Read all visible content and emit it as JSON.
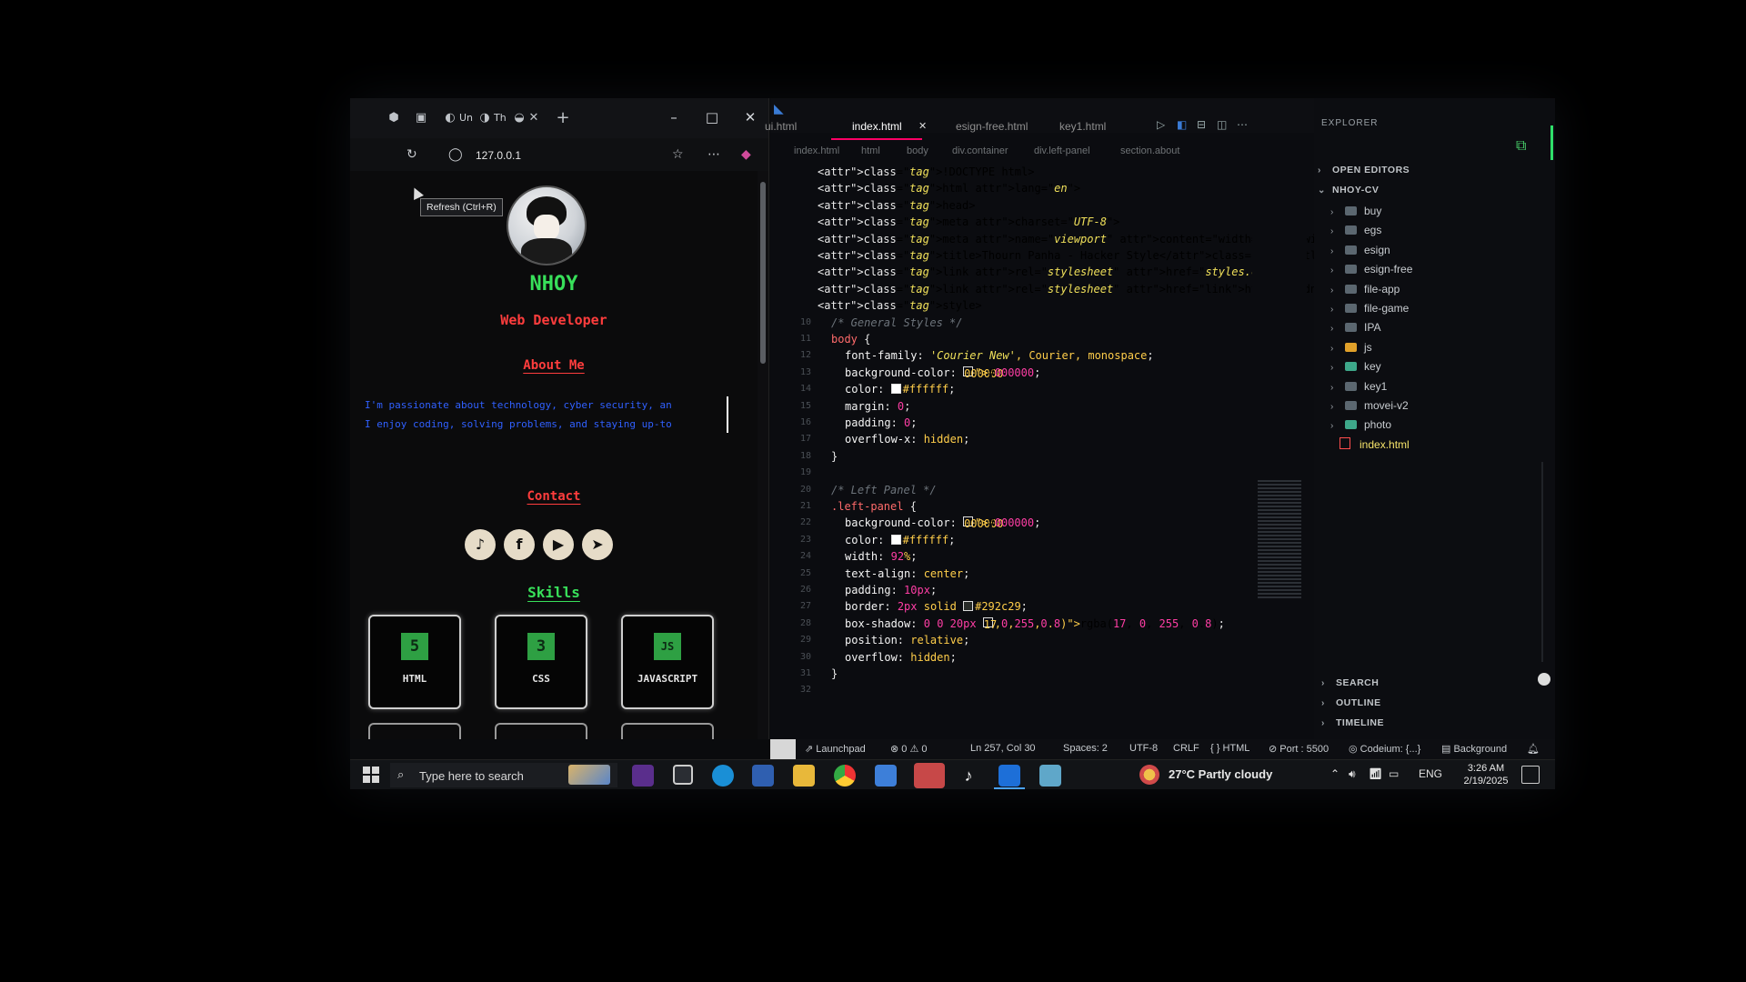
{
  "browser": {
    "tabs": [
      {
        "label": "Un"
      },
      {
        "label": "Th"
      }
    ],
    "new_tab": "+",
    "window": {
      "minimize": "–",
      "maximize": "□",
      "close": "✕"
    },
    "url": "127.0.0.1",
    "tooltip": "Refresh (Ctrl+R)",
    "more": "⋯"
  },
  "page": {
    "name": "NHOY",
    "role": "Web Developer",
    "about_title": "About Me",
    "about_lines": [
      "I'm passionate about technology, cyber security, an",
      "I enjoy coding, solving problems, and staying up-to"
    ],
    "contact_title": "Contact",
    "socials": [
      "♪",
      "f",
      "▶",
      "➤"
    ],
    "skills_title": "Skills",
    "skills": [
      {
        "icon": "5",
        "label": "HTML"
      },
      {
        "icon": "3",
        "label": "CSS"
      },
      {
        "icon": "JS",
        "label": "JAVASCRIPT"
      }
    ],
    "colors": {
      "name": "#38e05a",
      "role": "#ff3d3d",
      "about": "#3060ff"
    }
  },
  "editor": {
    "tabs": [
      {
        "label": "ui.html"
      },
      {
        "label": "index.html",
        "active": true
      },
      {
        "label": "esign-free.html"
      },
      {
        "label": "key1.html"
      }
    ],
    "breadcrumb": [
      "index.html",
      "html",
      "body",
      "div.container",
      "div.left-panel",
      "section.about"
    ],
    "lines": [
      {
        "n": "",
        "code": "<!DOCTYPE html>"
      },
      {
        "n": "",
        "code": "<html lang=\"en\">"
      },
      {
        "n": "",
        "code": "<head>"
      },
      {
        "n": "",
        "code": "<meta charset=\"UTF-8\">"
      },
      {
        "n": "",
        "code": "<meta name=\"viewport\" content=\"width=device-width, initial-"
      },
      {
        "n": "",
        "code": "<title>Thourn Panha - Hacker Style</title>"
      },
      {
        "n": "",
        "code": "<link rel=\"stylesheet\" href=\"styles.css\">"
      },
      {
        "n": "",
        "code": "<link rel=\"stylesheet\" href=\"https://cdnjs.cloudflare.com/a"
      },
      {
        "n": "",
        "code": "<style>"
      },
      {
        "n": "10",
        "code": "/* General Styles */"
      },
      {
        "n": "11",
        "code": "body {"
      },
      {
        "n": "12",
        "code": "font-family: 'Courier New', Courier, monospace;"
      },
      {
        "n": "13",
        "code": "background-color: #000000;"
      },
      {
        "n": "14",
        "code": "color: #ffffff;"
      },
      {
        "n": "15",
        "code": "margin: 0;"
      },
      {
        "n": "16",
        "code": "padding: 0;"
      },
      {
        "n": "17",
        "code": "overflow-x: hidden;"
      },
      {
        "n": "18",
        "code": "}"
      },
      {
        "n": "19",
        "code": ""
      },
      {
        "n": "20",
        "code": "/* Left Panel */"
      },
      {
        "n": "21",
        "code": ".left-panel {"
      },
      {
        "n": "22",
        "code": "background-color: #000000;"
      },
      {
        "n": "23",
        "code": "color: #ffffff;"
      },
      {
        "n": "24",
        "code": "width: 92%;"
      },
      {
        "n": "25",
        "code": "text-align: center;"
      },
      {
        "n": "26",
        "code": "padding: 10px;"
      },
      {
        "n": "27",
        "code": "border: 2px solid #292c29;"
      },
      {
        "n": "28",
        "code": "box-shadow: 0 0 20px rgba(17, 0, 255, 0.8);"
      },
      {
        "n": "29",
        "code": "position: relative;"
      },
      {
        "n": "30",
        "code": "overflow: hidden;"
      },
      {
        "n": "31",
        "code": "}"
      },
      {
        "n": "32",
        "code": ""
      }
    ]
  },
  "explorer": {
    "title": "EXPLORER",
    "open_editors": "OPEN EDITORS",
    "project": "NHOY-CV",
    "folders": [
      "buy",
      "egs",
      "esign",
      "esign-free",
      "file-app",
      "file-game",
      "IPA",
      "js",
      "key",
      "key1",
      "movei-v2",
      "photo"
    ],
    "file": "index.html",
    "bottom": [
      "SEARCH",
      "OUTLINE",
      "TIMELINE"
    ]
  },
  "statusbar": {
    "launchpad": "Launchpad",
    "problems": "⊗ 0 ⚠ 0",
    "position": "Ln 257, Col 30",
    "spaces": "Spaces: 2",
    "encoding": "UTF-8",
    "eol": "CRLF",
    "language": "{ } HTML",
    "port": "Port : 5500",
    "codeium": "Codeium: {...}",
    "background": "Background"
  },
  "taskbar": {
    "search_placeholder": "Type here to search",
    "weather": "27°C  Partly cloudy",
    "lang": "ENG",
    "time": "3:26 AM",
    "date": "2/19/2025"
  }
}
